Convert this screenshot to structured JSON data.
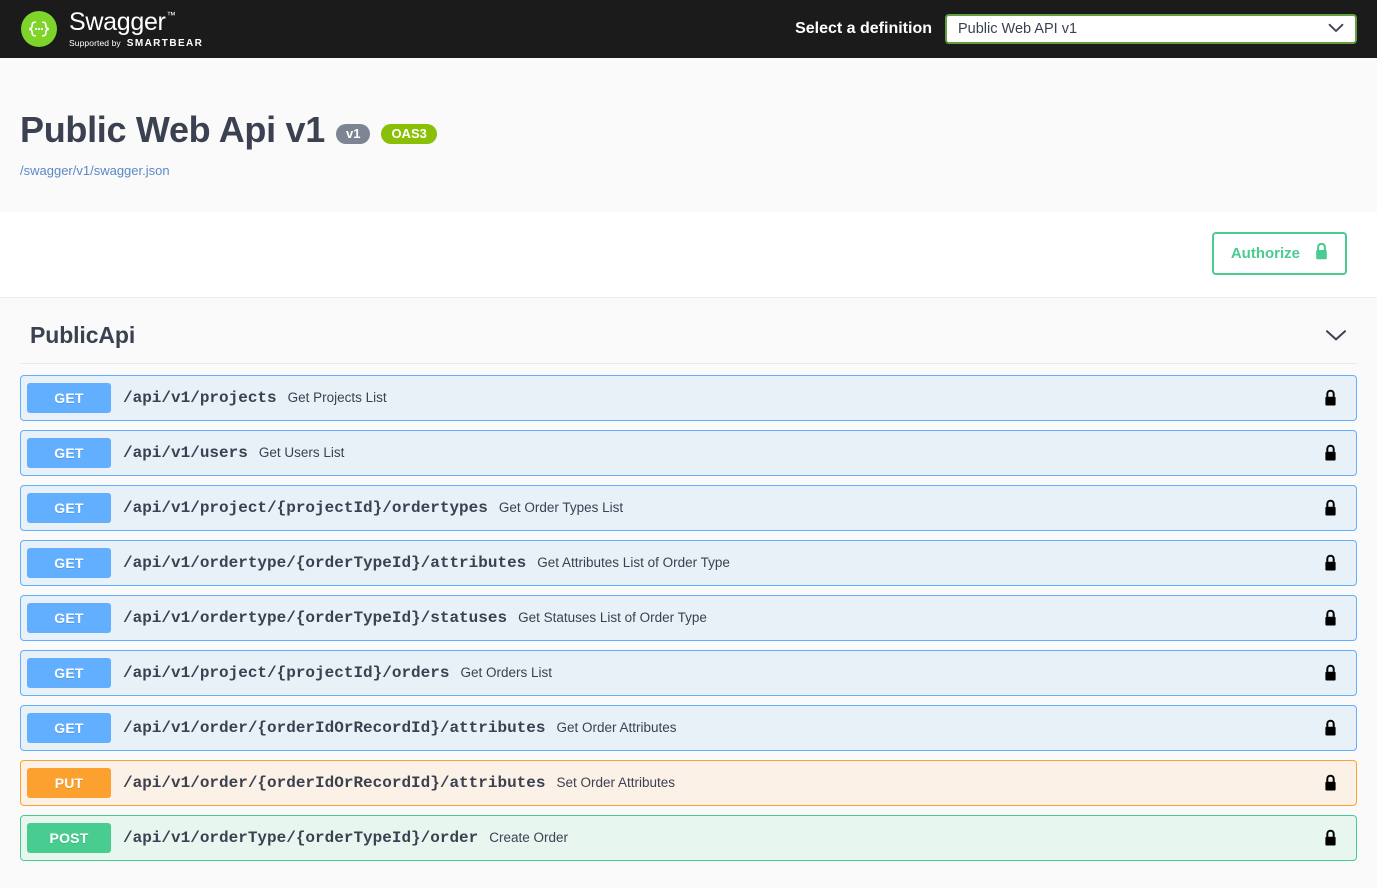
{
  "topbar": {
    "logo": {
      "icon": "swagger-braces-icon",
      "word": "Swagger",
      "trademark": "™",
      "supported_by": "Supported by",
      "brand": "SMARTBEAR"
    },
    "definition_label": "Select a definition",
    "definition_selected": "Public Web API v1",
    "definition_options": [
      "Public Web API v1"
    ],
    "chevron_icon": "chevron-down-icon"
  },
  "info": {
    "title": "Public Web Api v1",
    "version_badge": "v1",
    "oas_badge": "OAS3",
    "url": "/swagger/v1/swagger.json"
  },
  "auth": {
    "label": "Authorize",
    "lock_icon": "lock-icon"
  },
  "tag": {
    "name": "PublicApi",
    "chevron_icon": "chevron-down-icon"
  },
  "operations": [
    {
      "method": "GET",
      "style": "get",
      "path": "/api/v1/projects",
      "summary": "Get Projects List",
      "lock_icon": "lock-icon"
    },
    {
      "method": "GET",
      "style": "get",
      "path": "/api/v1/users",
      "summary": "Get Users List",
      "lock_icon": "lock-icon"
    },
    {
      "method": "GET",
      "style": "get",
      "path": "/api/v1/project/{projectId}/ordertypes",
      "summary": "Get Order Types List",
      "lock_icon": "lock-icon"
    },
    {
      "method": "GET",
      "style": "get",
      "path": "/api/v1/ordertype/{orderTypeId}/attributes",
      "summary": "Get Attributes List of Order Type",
      "lock_icon": "lock-icon"
    },
    {
      "method": "GET",
      "style": "get",
      "path": "/api/v1/ordertype/{orderTypeId}/statuses",
      "summary": "Get Statuses List of Order Type",
      "lock_icon": "lock-icon"
    },
    {
      "method": "GET",
      "style": "get",
      "path": "/api/v1/project/{projectId}/orders",
      "summary": "Get Orders List",
      "lock_icon": "lock-icon"
    },
    {
      "method": "GET",
      "style": "get",
      "path": "/api/v1/order/{orderIdOrRecordId}/attributes",
      "summary": "Get Order Attributes",
      "lock_icon": "lock-icon"
    },
    {
      "method": "PUT",
      "style": "put",
      "path": "/api/v1/order/{orderIdOrRecordId}/attributes",
      "summary": "Set Order Attributes",
      "lock_icon": "lock-icon"
    },
    {
      "method": "POST",
      "style": "post",
      "path": "/api/v1/orderType/{orderTypeId}/order",
      "summary": "Create Order",
      "lock_icon": "lock-icon"
    }
  ],
  "colors": {
    "topbar_bg": "#1b1b1b",
    "brand_green": "#89bf04",
    "logo_green": "#7fd42a",
    "get_blue": "#61affe",
    "put_orange": "#fca130",
    "post_green": "#49cc90",
    "version_gray": "#7d8492",
    "link_blue": "#5b88c7",
    "text_dark": "#3b4151"
  }
}
